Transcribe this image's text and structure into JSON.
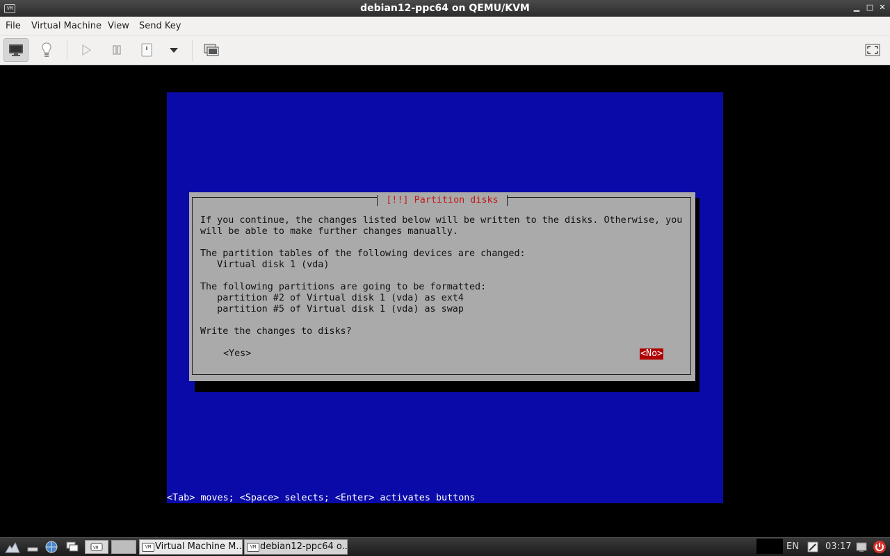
{
  "window": {
    "title": "debian12-ppc64 on QEMU/KVM",
    "app_icon_text": "VM",
    "minimize": "▁",
    "maximize": "□",
    "close": "✕"
  },
  "menu": [
    "File",
    "Virtual Machine",
    "View",
    "Send Key"
  ],
  "toolbar": {
    "items": [
      "console-icon",
      "details-icon",
      "run-icon",
      "pause-icon",
      "shutdown-icon",
      "shutdown-menu-icon",
      "snapshots-icon",
      "fullscreen-icon"
    ]
  },
  "installer": {
    "dialog_title": "[!!] Partition disks",
    "lines": [
      "If you continue, the changes listed below will be written to the disks. Otherwise, you",
      "will be able to make further changes manually.",
      "",
      "The partition tables of the following devices are changed:",
      "   Virtual disk 1 (vda)",
      "",
      "The following partitions are going to be formatted:",
      "   partition #2 of Virtual disk 1 (vda) as ext4",
      "   partition #5 of Virtual disk 1 (vda) as swap",
      "",
      "Write the changes to disks?"
    ],
    "yes_label": "<Yes>",
    "no_label": "<No>",
    "help_line": "<Tab> moves; <Space> selects; <Enter> activates buttons",
    "colors": {
      "background": "#0a0aa8",
      "dialog": "#aaaaaa",
      "title": "#c11a1a",
      "selected": "#b00000"
    }
  },
  "taskbar": {
    "tasks": [
      {
        "label": "Virtual Machine M..."
      },
      {
        "label": "debian12-ppc64 o..."
      }
    ],
    "keyboard_layout": "EN",
    "clock": "03:17"
  }
}
